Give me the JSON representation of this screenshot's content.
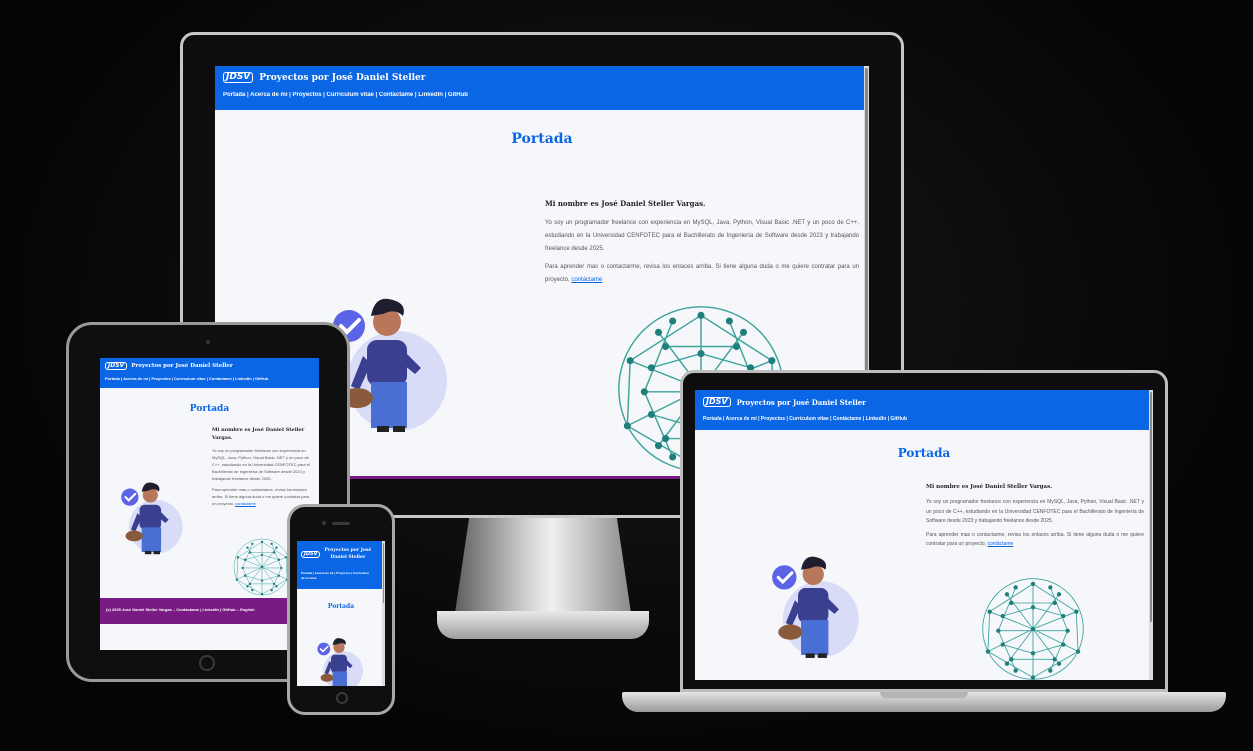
{
  "site": {
    "logo": "JDSV",
    "title": "Proyectos por José Daniel Steller",
    "nav": "Portada | Acerca de mí | Proyectos | Currículum vitae | Contáctame | LinkedIn | GitHub",
    "page_title": "Portada",
    "name_line": "Mi nombre es José Daniel Steller Vargas.",
    "bio": "Yo soy un programador freelance con experiencia en MySQL, Java, Python, Visual Basic .NET y un poco de C++, estudiando en la Universidad CENFOTEC para el Bachillerato de Ingeniería de Software desde 2023 y trabajando freelance desde 2025.",
    "contact_text": "Para aprender mas o contactarme, revisa los enlaces arriba. Si tiene alguna duda o me quiere contratar para un proyecto,",
    "contact_link": "contáctame",
    "footer": "(c) 2025 José Daniel Steller Vargas – Contáctame | LinkedIn | GitHub – English"
  },
  "phone": {
    "title_line1": "Proyectos por José",
    "title_line2": "Daniel Steller",
    "nav_line1": "Portada | Acerca de mí | Proyectos | Currículum",
    "nav_line2": "de mí          vitae"
  },
  "colors": {
    "brand": "#0a66e4",
    "footer": "#7a1a84",
    "background": "#0b0b0b"
  }
}
